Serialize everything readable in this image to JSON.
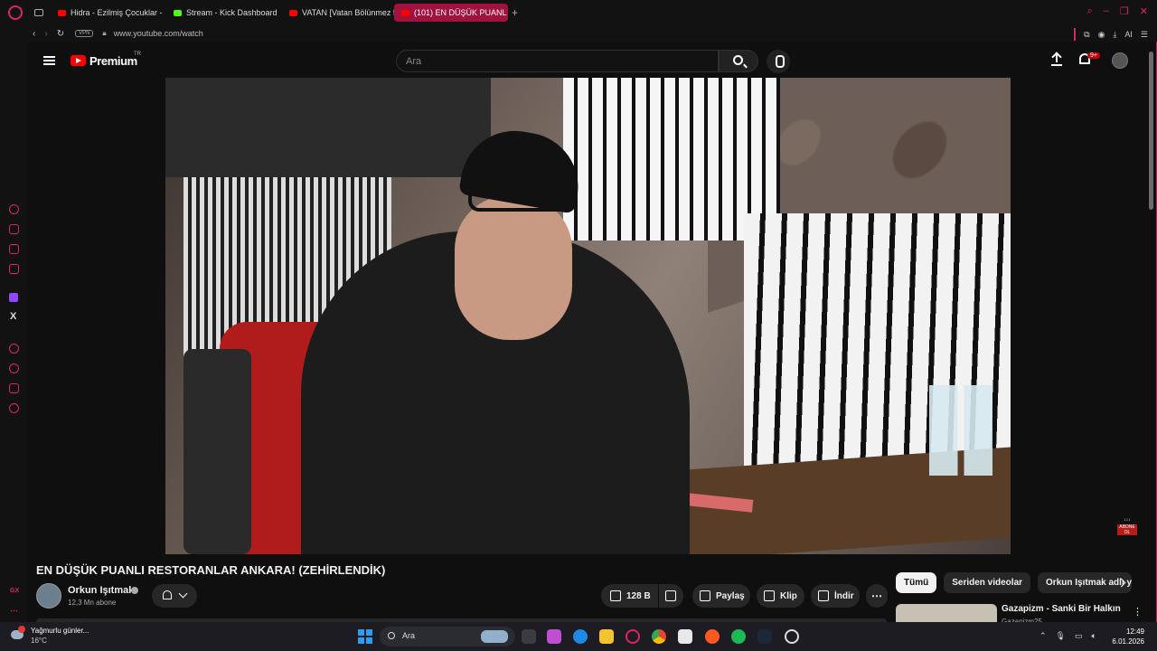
{
  "browser": {
    "tabs": [
      {
        "label": "Hidra - Ezilmiş Çocuklar -",
        "favicon_color": "#ff0000"
      },
      {
        "label": "Stream - Kick Dashboard",
        "favicon_color": "#53fc18"
      },
      {
        "label": "VATAN [Vatan Bölünmez 5",
        "favicon_color": "#ff0000"
      },
      {
        "label": "(101) EN DÜŞÜK PUANL",
        "favicon_color": "#ff0000",
        "active": true
      }
    ],
    "url": "www.youtube.com/watch",
    "vpn_label": "VPN",
    "ai_label": "AI",
    "new_tab": "+"
  },
  "youtube": {
    "logo_text": "Premium",
    "region": "TR",
    "search_placeholder": "Ara",
    "notifications_badge": "9+",
    "video_title": "EN DÜŞÜK PUANLI RESTORANLAR ANKARA! (ZEHİRLENDİK)",
    "channel": {
      "name": "Orkun Işıtmak",
      "subscribers": "12,3 Mn abone"
    },
    "actions": {
      "like_count": "128 B",
      "share": "Paylaş",
      "clip": "Klip",
      "download": "İndir",
      "more": "⋯"
    },
    "chips": [
      "Tümü",
      "Seriden videolar",
      "Orkun Işıtmak adlı yü"
    ],
    "recommendation": {
      "title": "Gazapizm - Sanki Bir Halkın",
      "channel": "Gazapizm25"
    },
    "watermark_text": "ABONE OL"
  },
  "taskbar": {
    "weather_title": "Yağmurlu günler...",
    "weather_temp": "16°C",
    "search_label": "Ara",
    "time": "12:49",
    "date": "6.01.2026"
  },
  "accent_colors": {
    "opera": "#e0245e",
    "youtube_red": "#ff0000",
    "active_tab": "#a1123f"
  }
}
